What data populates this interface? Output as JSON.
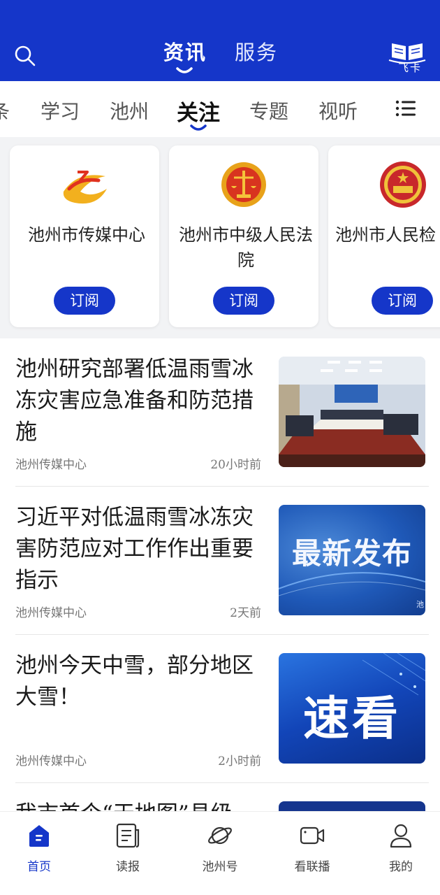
{
  "header": {
    "tabs": [
      "资讯",
      "服务"
    ],
    "active_tab": "资讯",
    "feika_label": "飞卡",
    "brand_color": "#1536c9"
  },
  "channels": {
    "items": [
      "条",
      "学习",
      "池州",
      "关注",
      "专题",
      "视听"
    ],
    "active": "关注"
  },
  "subscriptions": [
    {
      "name": "池州市传媒中心",
      "button": "订阅",
      "icon": "media-center-logo"
    },
    {
      "name": "池州市中级人民法院",
      "button": "订阅",
      "icon": "court-emblem"
    },
    {
      "name": "池州市人民检",
      "button": "订阅",
      "icon": "procuratorate-emblem"
    }
  ],
  "news": [
    {
      "title": "池州研究部署低温雨雪冰冻灾害应急准备和防范措施",
      "source": "池州传媒中心",
      "time": "20小时前",
      "thumb": "meeting-photo"
    },
    {
      "title": "习近平对低温雨雪冰冻灾害防范应对工作作出重要指示",
      "source": "池州传媒中心",
      "time": "2天前",
      "thumb": "最新发布",
      "thumb_note": "池"
    },
    {
      "title": "池州今天中雪，部分地区大雪！",
      "source": "池州传媒中心",
      "time": "2小时前",
      "thumb": "速看"
    },
    {
      "title": "我市首个“天地图”县级",
      "source": "",
      "time": "",
      "thumb": "blue-banner"
    }
  ],
  "bottom_nav": [
    {
      "label": "首页",
      "icon": "home-icon",
      "active": true
    },
    {
      "label": "读报",
      "icon": "newspaper-icon",
      "active": false
    },
    {
      "label": "池州号",
      "icon": "planet-icon",
      "active": false
    },
    {
      "label": "看联播",
      "icon": "video-icon",
      "active": false
    },
    {
      "label": "我的",
      "icon": "user-icon",
      "active": false
    }
  ]
}
